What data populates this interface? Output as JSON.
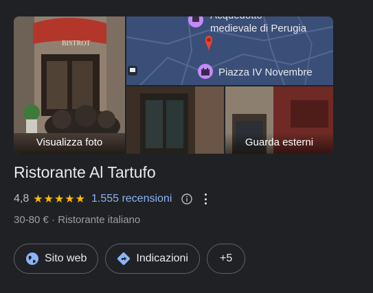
{
  "gallery": {
    "photos_label": "Visualizza foto",
    "exterior_label": "Guarda esterni",
    "map": {
      "label_top": "Acquedotto\nmedievale di Perugia",
      "label_piazza": "Piazza IV Novembre"
    }
  },
  "place": {
    "name": "Ristorante Al Tartufo",
    "rating": "4,8",
    "stars": "★★★★★",
    "reviews": "1.555 recensioni",
    "meta": "30-80 € · Ristorante italiano"
  },
  "actions": {
    "website": "Sito web",
    "directions": "Indicazioni",
    "more": "+5"
  },
  "colors": {
    "background": "#202124",
    "link": "#8ab4f8",
    "star": "#fbbc04",
    "map_pin": "#ea4335",
    "map_marker": "#c58af9"
  }
}
